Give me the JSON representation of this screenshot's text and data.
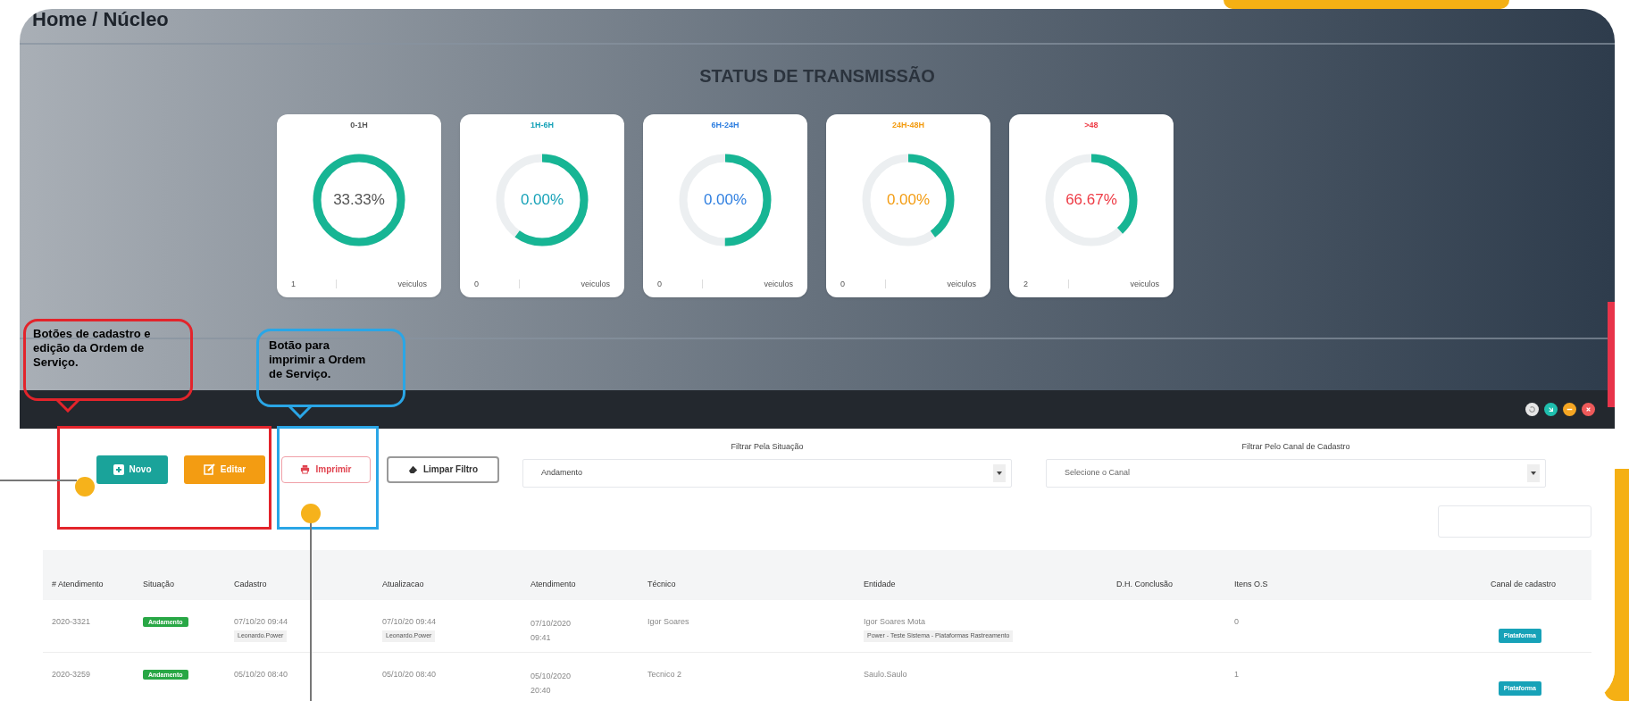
{
  "breadcrumb": "Home / Núcleo",
  "status_panel": {
    "title": "STATUS DE TRANSMISSÃO",
    "cards": [
      {
        "label": "0-1H",
        "color": "#555555",
        "percent": "33.33%",
        "level": 1,
        "count": "1",
        "unit": "veiculos"
      },
      {
        "label": "1H-6H",
        "color": "#17a2b8",
        "percent": "0.00%",
        "level": 0.6,
        "count": "0",
        "unit": "veiculos"
      },
      {
        "label": "6H-24H",
        "color": "#2f7fe0",
        "percent": "0.00%",
        "level": 0.5,
        "count": "0",
        "unit": "veiculos"
      },
      {
        "label": "24H-48H",
        "color": "#f39c12",
        "percent": "0.00%",
        "level": 0.4,
        "count": "0",
        "unit": "veiculos"
      },
      {
        "label": ">48",
        "color": "#ee3b45",
        "percent": "66.67%",
        "level": 0.38,
        "count": "2",
        "unit": "veiculos"
      }
    ]
  },
  "toolbar": {
    "buttons": [
      {
        "kind": "new",
        "label": "Novo"
      },
      {
        "kind": "edit",
        "label": "Editar"
      },
      {
        "kind": "print",
        "label": "Imprimir"
      },
      {
        "kind": "clear",
        "label": "Limpar Filtro"
      }
    ]
  },
  "filters": [
    {
      "label": "Filtrar Pela Situação",
      "value": "Andamento"
    },
    {
      "label": "Filtrar Pelo Canal de Cadastro",
      "placeholder": "Selecione o Canal"
    }
  ],
  "table": {
    "columns": [
      "# Atendimento",
      "Situação",
      "Cadastro",
      "Atualizacao",
      "Atendimento",
      "Técnico",
      "Entidade",
      "D.H. Conclusão",
      "Itens O.S",
      "Canal de cadastro"
    ],
    "rows": [
      {
        "numero": "2020-3321",
        "situacao": "Andamento",
        "cadastro": "07/10/20 09:44",
        "cadastro_user": "Leonardo.Power",
        "atualizacao": "07/10/20 09:44",
        "atualizacao_user": "Leonardo.Power",
        "atendimento": "07/10/2020 09:41",
        "tecnico": "Igor Soares",
        "entidade": "Igor Soares Mota",
        "entidade_tag": "Power - Teste Sistema - Plataformas Rastreamento",
        "itens": "0",
        "canal": "Plataforma"
      },
      {
        "numero": "2020-3259",
        "situacao": "Andamento",
        "cadastro": "05/10/20 08:40",
        "atualizacao": "05/10/20 08:40",
        "atendimento": "05/10/2020 20:40",
        "tecnico": "Tecnico 2",
        "entidade": "Saulo.Saulo",
        "itens": "1",
        "canal": "Plataforma"
      }
    ]
  },
  "annotations": [
    {
      "text": "Botões de cadastro e edição da Ordem de Serviço.",
      "color": "#e3242b"
    },
    {
      "text": "Botão para imprimir a Ordem de Serviço.",
      "color": "#2aa6e6"
    }
  ]
}
